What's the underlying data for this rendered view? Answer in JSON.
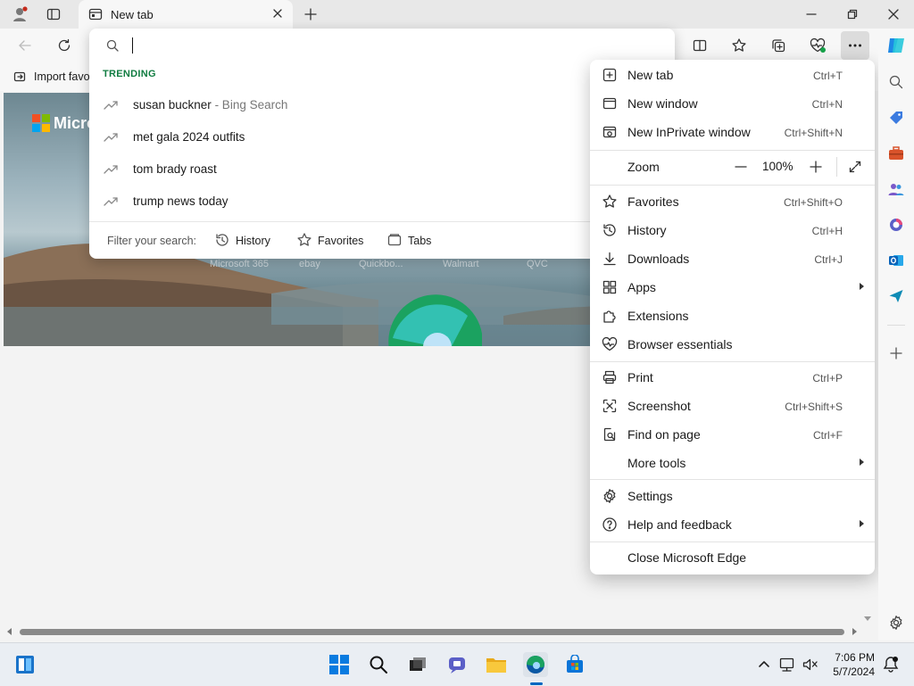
{
  "tab": {
    "title": "New tab"
  },
  "favorites_bar": {
    "import_label": "Import favo"
  },
  "search": {
    "placeholder": "",
    "trending_label": "TRENDING",
    "suggestions": [
      {
        "text": "susan buckner",
        "suffix": " - Bing Search"
      },
      {
        "text": "met gala 2024 outfits",
        "suffix": ""
      },
      {
        "text": "tom brady roast",
        "suffix": ""
      },
      {
        "text": "trump news today",
        "suffix": ""
      }
    ],
    "filter_label": "Filter your search:",
    "filters": [
      "History",
      "Favorites",
      "Tabs"
    ]
  },
  "hero": {
    "brand": "Micro",
    "quick_links": [
      "Microsoft 365",
      "ebay",
      "Quickbo...",
      "Walmart",
      "QVC"
    ]
  },
  "menu": {
    "items": [
      {
        "label": "New tab",
        "shortcut": "Ctrl+T",
        "icon": "new-tab-icon"
      },
      {
        "label": "New window",
        "shortcut": "Ctrl+N",
        "icon": "window-icon"
      },
      {
        "label": "New InPrivate window",
        "shortcut": "Ctrl+Shift+N",
        "icon": "inprivate-icon"
      },
      {
        "label": "Favorites",
        "shortcut": "Ctrl+Shift+O",
        "icon": "star-icon"
      },
      {
        "label": "History",
        "shortcut": "Ctrl+H",
        "icon": "history-icon"
      },
      {
        "label": "Downloads",
        "shortcut": "Ctrl+J",
        "icon": "download-icon"
      },
      {
        "label": "Apps",
        "shortcut": "",
        "icon": "apps-icon"
      },
      {
        "label": "Extensions",
        "shortcut": "",
        "icon": "puzzle-icon"
      },
      {
        "label": "Browser essentials",
        "shortcut": "",
        "icon": "heart-pulse-icon"
      },
      {
        "label": "Print",
        "shortcut": "Ctrl+P",
        "icon": "printer-icon"
      },
      {
        "label": "Screenshot",
        "shortcut": "Ctrl+Shift+S",
        "icon": "screenshot-icon"
      },
      {
        "label": "Find on page",
        "shortcut": "Ctrl+F",
        "icon": "find-icon"
      },
      {
        "label": "More tools",
        "shortcut": "",
        "icon": ""
      },
      {
        "label": "Settings",
        "shortcut": "",
        "icon": "gear-icon"
      },
      {
        "label": "Help and feedback",
        "shortcut": "",
        "icon": "help-icon"
      },
      {
        "label": "Close Microsoft Edge",
        "shortcut": "",
        "icon": ""
      }
    ],
    "zoom": {
      "label": "Zoom",
      "value": "100%"
    }
  },
  "clock": {
    "time": "7:06 PM",
    "date": "5/7/2024"
  },
  "colors": {
    "accent_green": "#107c41",
    "edge_blue": "#0c59a4",
    "menu_bg": "#ffffff"
  }
}
